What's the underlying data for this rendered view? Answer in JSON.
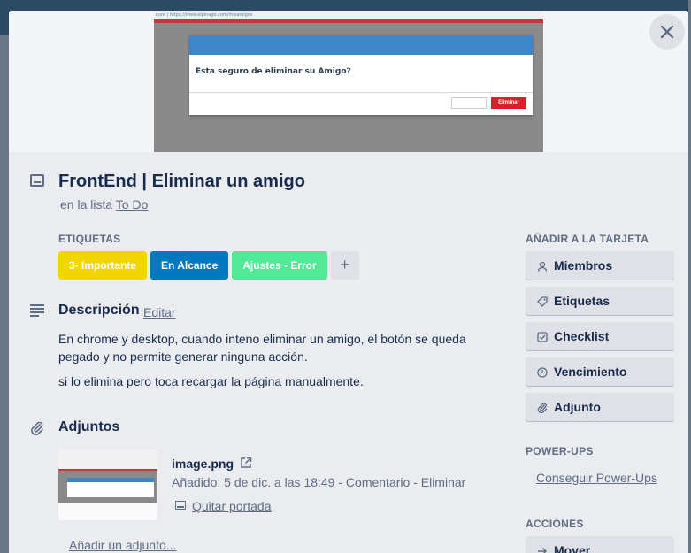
{
  "cover": {
    "url_text": "cure | https://www.elpinago.com/misamigos",
    "dialog_text": "Esta seguro de eliminar su Amigo?",
    "dialog_delete": "Eliminar"
  },
  "card": {
    "title": "FrontEnd | Eliminar un amigo",
    "list_prefix": "en la lista",
    "list_name": "To Do"
  },
  "labels": {
    "heading": "ETIQUETAS",
    "items": [
      {
        "text": "3- Importante",
        "color": "#f2d600"
      },
      {
        "text": "En Alcance",
        "color": "#0079bf"
      },
      {
        "text": "Ajustes - Error",
        "color": "#51e898"
      }
    ],
    "add": "+"
  },
  "description": {
    "title": "Descripción",
    "edit": "Editar",
    "paragraphs": [
      "En chrome y desktop, cuando inteno eliminar un amigo, el botón se queda pegado y no permite generar ninguna acción.",
      "si lo elimina pero toca recargar la página manualmente."
    ]
  },
  "attachments": {
    "title": "Adjuntos",
    "file_name": "image.png",
    "added": "Añadido: 5 de dic. a las 18:49",
    "separator": "-",
    "comment": "Comentario",
    "delete": "Eliminar",
    "remove_cover": "Quitar portada",
    "add": "Añadir un adjunto..."
  },
  "sidebar": {
    "add_heading": "AÑADIR A LA TARJETA",
    "buttons": [
      {
        "label": "Miembros",
        "icon": "person-icon"
      },
      {
        "label": "Etiquetas",
        "icon": "tag-icon"
      },
      {
        "label": "Checklist",
        "icon": "checkbox-icon"
      },
      {
        "label": "Vencimiento",
        "icon": "clock-icon"
      },
      {
        "label": "Adjunto",
        "icon": "paperclip-icon"
      }
    ],
    "powerups_heading": "POWER-UPS",
    "powerups_link": "Conseguir Power-Ups",
    "actions_heading": "ACCIONES",
    "actions": [
      {
        "label": "Mover",
        "icon": "arrow-right-icon"
      }
    ]
  }
}
